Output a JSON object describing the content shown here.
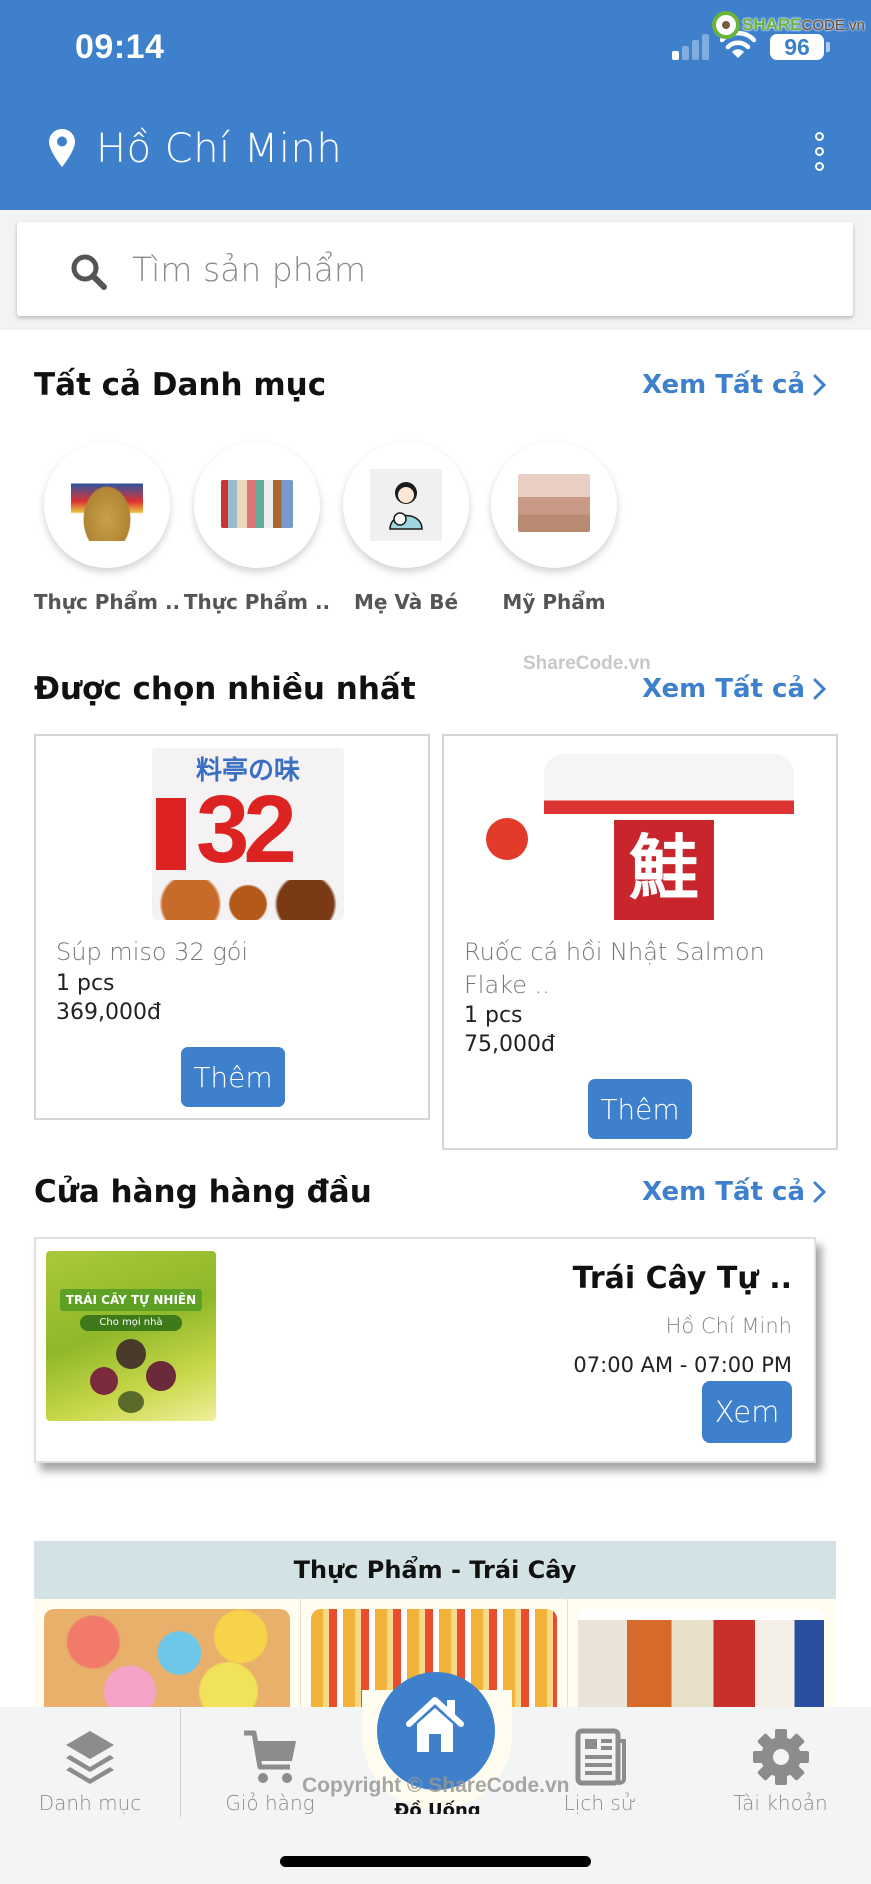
{
  "status_bar": {
    "time": "09:14",
    "battery": "96",
    "signal_bars_active": 1,
    "signal_bars_total": 4
  },
  "watermark": {
    "logo_primary": "SHARE",
    "logo_secondary": "CODE.vn",
    "inline_text": "ShareCode.vn",
    "copyright": "Copyright © ShareCode.vn"
  },
  "header": {
    "location": "Hồ Chí Minh",
    "location_icon": "map-pin-icon",
    "menu_icon": "more-vertical-icon"
  },
  "search": {
    "placeholder": "Tìm sản phẩm",
    "value": ""
  },
  "categories_section": {
    "title": "Tất cả Danh mục",
    "see_all": "Xem Tất cả",
    "items": [
      {
        "label": "Thực Phẩm .."
      },
      {
        "label": "Thực Phẩm .."
      },
      {
        "label": "Mẹ Và Bé"
      },
      {
        "label": "Mỹ Phẩm"
      }
    ]
  },
  "popular_section": {
    "title": "Được chọn nhiều nhất",
    "see_all": "Xem Tất cả",
    "products": [
      {
        "name": "Súp miso 32 gói",
        "qty": "1 pcs",
        "price": "369,000đ",
        "button": "Thêm"
      },
      {
        "name": "Ruốc cá hồi Nhật Salmon Flake ..",
        "qty": "1 pcs",
        "price": "75,000đ",
        "button": "Thêm"
      }
    ]
  },
  "stores_section": {
    "title": "Cửa hàng hàng đầu",
    "see_all": "Xem Tất cả",
    "stores": [
      {
        "name": "Trái Cây Tự ..",
        "city": "Hồ Chí Minh",
        "hours": "07:00 AM - 07:00 PM",
        "button": "Xem",
        "image_banner": "TRÁI CÂY TỰ NHIÊN",
        "image_sub": "Cho mọi nhà"
      }
    ]
  },
  "category_grid": {
    "title": "Thực Phẩm - Trái Cây",
    "partial_label": "Đồ Uống"
  },
  "bottom_nav": {
    "items": [
      {
        "label": "Danh mục",
        "icon": "layers-icon"
      },
      {
        "label": "Giỏ hàng",
        "icon": "cart-icon"
      },
      {
        "label": "",
        "icon": "home-icon"
      },
      {
        "label": "Lịch sử",
        "icon": "newspaper-icon"
      },
      {
        "label": "Tài khoản",
        "icon": "gear-icon"
      }
    ]
  },
  "colors": {
    "primary": "#3e80cc",
    "background": "#ffffff",
    "search_bg": "#f2f3f5",
    "grid_header": "#d3e2e4",
    "nav_bg": "#f3f4f6",
    "nav_text": "#8c8c8c"
  }
}
